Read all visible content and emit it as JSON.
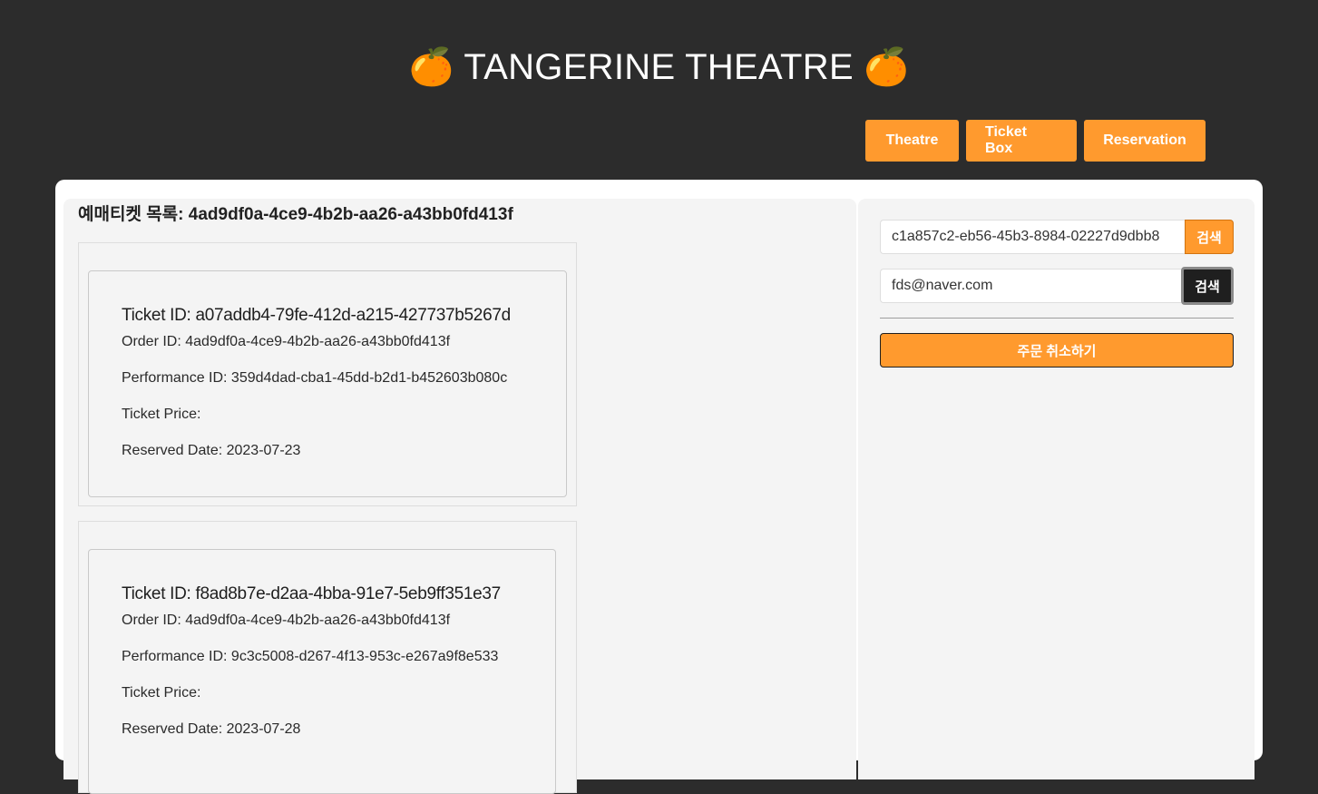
{
  "header": {
    "title": "TANGERINE THEATRE",
    "emoji_left": "🍊",
    "emoji_right": "🍊"
  },
  "nav": {
    "theatre": "Theatre",
    "ticket_box": "Ticket Box",
    "reservation": "Reservation"
  },
  "list": {
    "title": "예매티켓 목록: 4ad9df0a-4ce9-4b2b-aa26-a43bb0fd413f"
  },
  "tickets": [
    {
      "ticket_id": "Ticket ID: a07addb4-79fe-412d-a215-427737b5267d",
      "order_id": "Order ID: 4ad9df0a-4ce9-4b2b-aa26-a43bb0fd413f",
      "performance_id": "Performance ID: 359d4dad-cba1-45dd-b2d1-b452603b080c",
      "ticket_price": "Ticket Price:",
      "reserved_date": "Reserved Date: 2023-07-23"
    },
    {
      "ticket_id": "Ticket ID: f8ad8b7e-d2aa-4bba-91e7-5eb9ff351e37",
      "order_id": "Order ID: 4ad9df0a-4ce9-4b2b-aa26-a43bb0fd413f",
      "performance_id": "Performance ID: 9c3c5008-d267-4f13-953c-e267a9f8e533",
      "ticket_price": "Ticket Price:",
      "reserved_date": "Reserved Date: 2023-07-28"
    }
  ],
  "search": {
    "order_value": "c1a857c2-eb56-45b3-8984-02227d9dbb8",
    "order_button": "검색",
    "email_value": "fds@naver.com",
    "email_button": "검색"
  },
  "cancel_button": "주문 취소하기",
  "colors": {
    "background": "#2c2c2c",
    "accent": "#ff9a2e",
    "panel": "#f4f4f4"
  }
}
